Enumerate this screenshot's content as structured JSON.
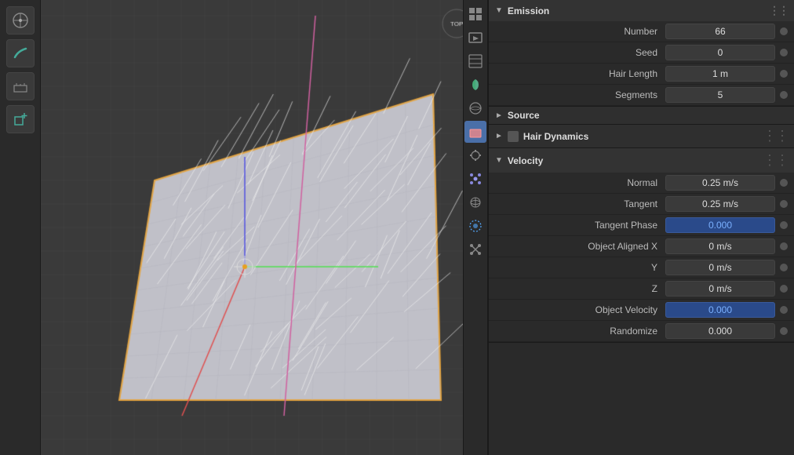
{
  "toolbar": {
    "tools": [
      {
        "name": "transform",
        "icon": "⊕"
      },
      {
        "name": "draw",
        "icon": "✏"
      },
      {
        "name": "measure",
        "icon": "📐"
      },
      {
        "name": "add-object",
        "icon": "⬡"
      }
    ]
  },
  "sidebar_icons": [
    {
      "name": "render",
      "icon": "▦",
      "active": false
    },
    {
      "name": "output",
      "icon": "🎬",
      "active": false
    },
    {
      "name": "view-layer",
      "icon": "🖼",
      "active": false
    },
    {
      "name": "scene",
      "icon": "💧",
      "active": false
    },
    {
      "name": "world",
      "icon": "🌐",
      "active": false
    },
    {
      "name": "object",
      "icon": "🟧",
      "active": true
    },
    {
      "name": "modifier",
      "icon": "🔧",
      "active": false
    },
    {
      "name": "particles",
      "icon": "✳",
      "active": false
    },
    {
      "name": "physics",
      "icon": "🌀",
      "active": false
    },
    {
      "name": "constraints",
      "icon": "👁",
      "active": false
    },
    {
      "name": "object-data",
      "icon": "🔀",
      "active": false
    }
  ],
  "properties": {
    "emission": {
      "title": "Emission",
      "fields": [
        {
          "label": "Number",
          "value": "66",
          "blue": false
        },
        {
          "label": "Seed",
          "value": "0",
          "blue": false
        },
        {
          "label": "Hair Length",
          "value": "1 m",
          "blue": false
        },
        {
          "label": "Segments",
          "value": "5",
          "blue": false
        }
      ]
    },
    "source": {
      "title": "Source",
      "collapsed": true
    },
    "hair_dynamics": {
      "title": "Hair Dynamics",
      "checkbox": true
    },
    "velocity": {
      "title": "Velocity",
      "fields": [
        {
          "label": "Normal",
          "value": "0.25 m/s",
          "blue": false
        },
        {
          "label": "Tangent",
          "value": "0.25 m/s",
          "blue": false
        },
        {
          "label": "Tangent Phase",
          "value": "0.000",
          "blue": true
        },
        {
          "label": "Object Aligned X",
          "value": "0 m/s",
          "blue": false
        },
        {
          "label": "Y",
          "value": "0 m/s",
          "blue": false
        },
        {
          "label": "Z",
          "value": "0 m/s",
          "blue": false
        },
        {
          "label": "Object Velocity",
          "value": "0.000",
          "blue": true
        },
        {
          "label": "Randomize",
          "value": "0.000",
          "blue": false
        }
      ]
    }
  }
}
